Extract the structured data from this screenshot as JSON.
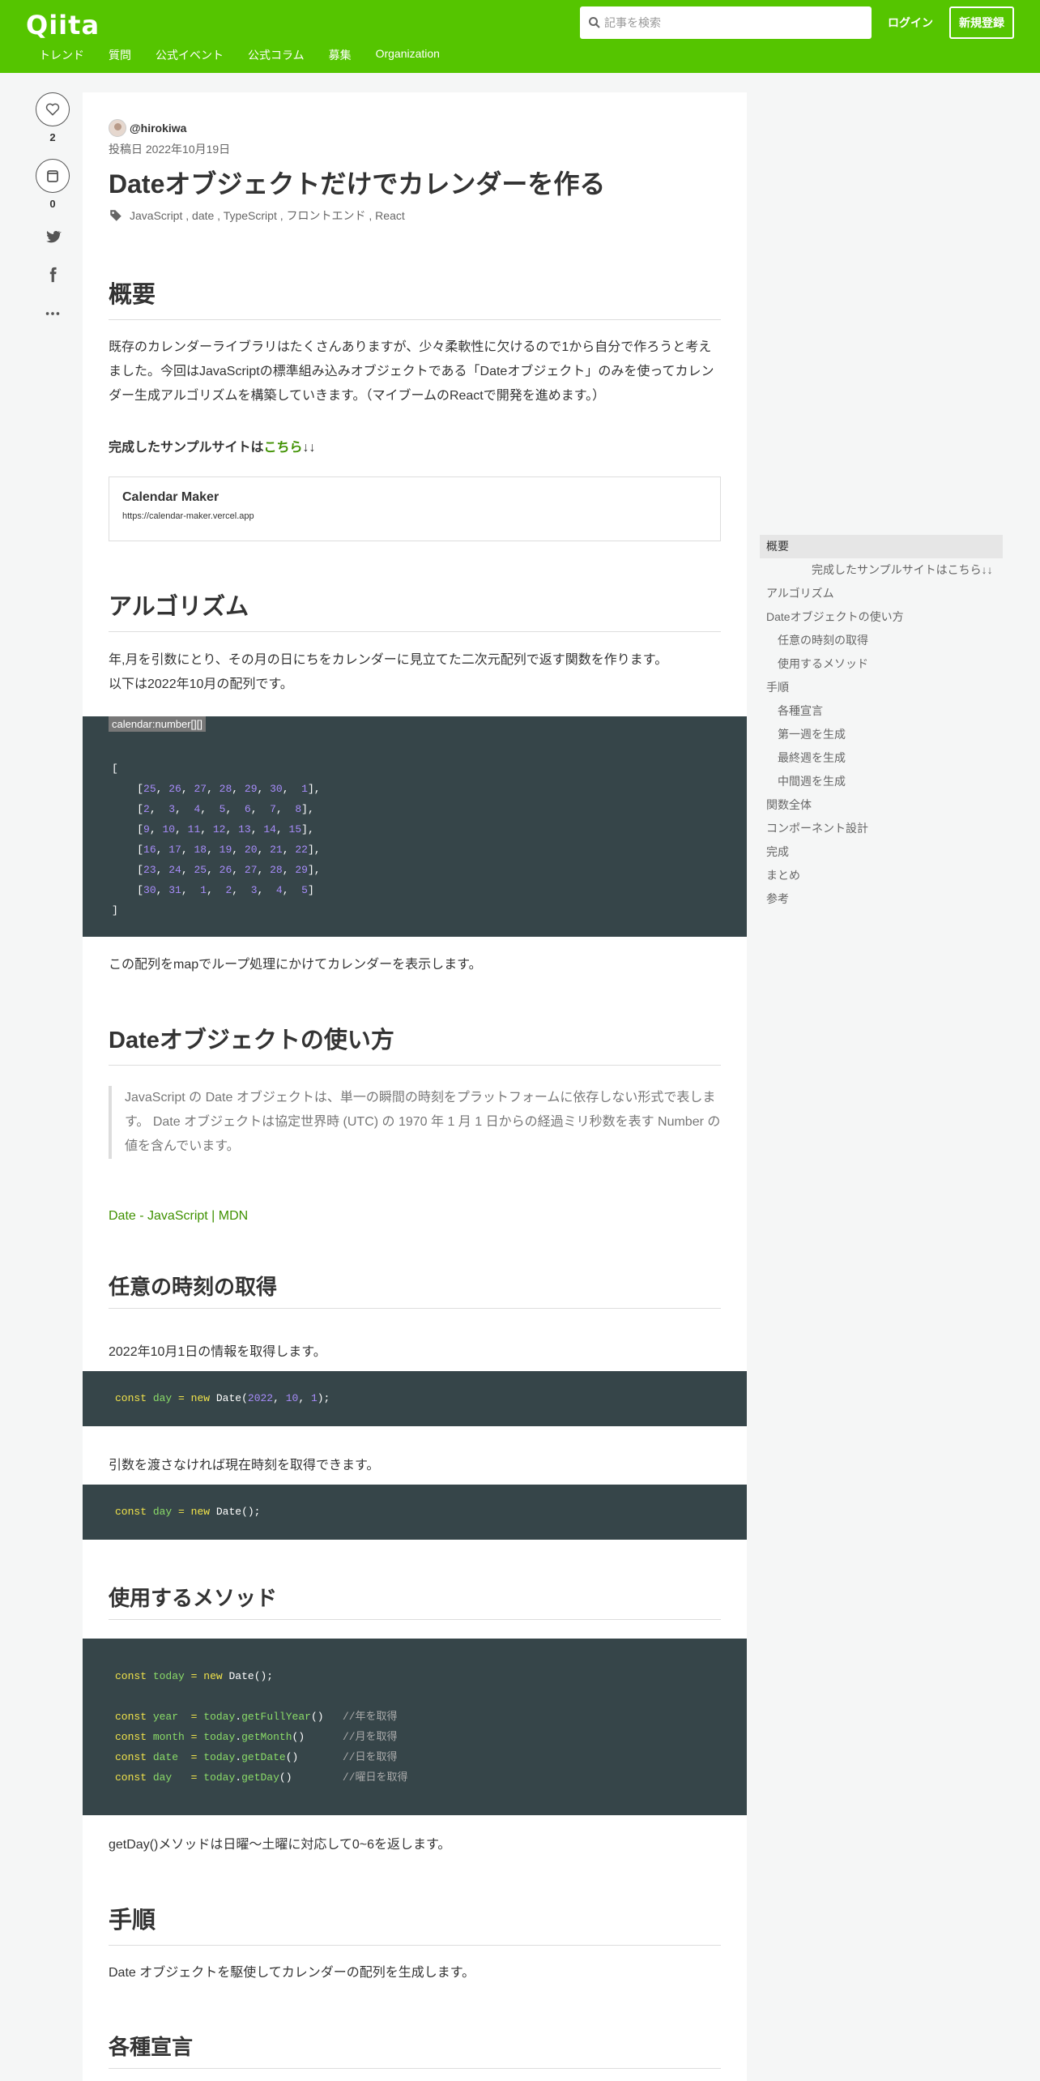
{
  "header": {
    "logo": "Qiita",
    "search_placeholder": "記事を検索",
    "login": "ログイン",
    "signup": "新規登録",
    "nav": [
      "トレンド",
      "質問",
      "公式イベント",
      "公式コラム",
      "募集",
      "Organization"
    ]
  },
  "actions": {
    "likes": "2",
    "stocks": "0"
  },
  "article": {
    "author": "@hirokiwa",
    "posted": "投稿日 2022年10月19日",
    "title": "Dateオブジェクトだけでカレンダーを作る",
    "tags": "JavaScript , date , TypeScript , フロントエンド , React",
    "h_overview": "概要",
    "p_overview": "既存のカレンダーライブラリはたくさんありますが、少々柔軟性に欠けるので1から自分で作ろうと考えました。今回はJavaScriptの標準組み込みオブジェクトである「Dateオブジェクト」のみを使ってカレンダー生成アルゴリズムを構築していきます。（マイブームのReactで開発を進めます。）",
    "sample_prefix": "完成したサンプルサイトは",
    "sample_link": "こちら",
    "sample_suffix": "↓↓",
    "card_title": "Calendar Maker",
    "card_url": "https://calendar-maker.vercel.app",
    "h_algorithm": "アルゴリズム",
    "p_algorithm_1": "年,月を引数にとり、その月の日にちをカレンダーに見立てた二次元配列で返す関数を作ります。",
    "p_algorithm_2": "以下は2022年10月の配列です。",
    "code_filename": "calendar:number[][]",
    "calendar_rows": [
      [
        "25",
        "26",
        "27",
        "28",
        "29",
        "30",
        "1"
      ],
      [
        "2",
        "3",
        "4",
        "5",
        "6",
        "7",
        "8"
      ],
      [
        "9",
        "10",
        "11",
        "12",
        "13",
        "14",
        "15"
      ],
      [
        "16",
        "17",
        "18",
        "19",
        "20",
        "21",
        "22"
      ],
      [
        "23",
        "24",
        "25",
        "26",
        "27",
        "28",
        "29"
      ],
      [
        "30",
        "31",
        "1",
        "2",
        "3",
        "4",
        "5"
      ]
    ],
    "p_map": "この配列をmapでループ処理にかけてカレンダーを表示します。",
    "h_date": "Dateオブジェクトの使い方",
    "quote": "JavaScript の Date オブジェクトは、単一の瞬間の時刻をプラットフォームに依存しない形式で表します。 Date オブジェクトは協定世界時 (UTC) の 1970 年 1 月 1 日からの経過ミリ秒数を表す Number の値を含んでいます。",
    "mdn_link": "Date - JavaScript | MDN",
    "h_anytime": "任意の時刻の取得",
    "p_anytime": "2022年10月1日の情報を取得します。",
    "p_now": "引数を渡さなければ現在時刻を取得できます。",
    "h_methods": "使用するメソッド",
    "comments": [
      "//年を取得",
      "//月を取得",
      "//日を取得",
      "//曜日を取得"
    ],
    "p_getday": "getDay()メソッドは日曜〜土曜に対応して0~6を返します。",
    "h_steps": "手順",
    "p_steps": "Date オブジェクトを駆使してカレンダーの配列を生成します。",
    "h_decl": "各種宣言"
  },
  "toc": [
    "概要",
    "完成したサンプルサイトはこちら↓↓",
    "アルゴリズム",
    "Dateオブジェクトの使い方",
    "任意の時刻の取得",
    "使用するメソッド",
    "手順",
    "各種宣言",
    "第一週を生成",
    "最終週を生成",
    "中間週を生成",
    "関数全体",
    "コンポーネント設計",
    "完成",
    "まとめ",
    "参考"
  ],
  "colors": {
    "brand": "#55c500",
    "code_bg": "#364549",
    "link": "#3f9100"
  }
}
